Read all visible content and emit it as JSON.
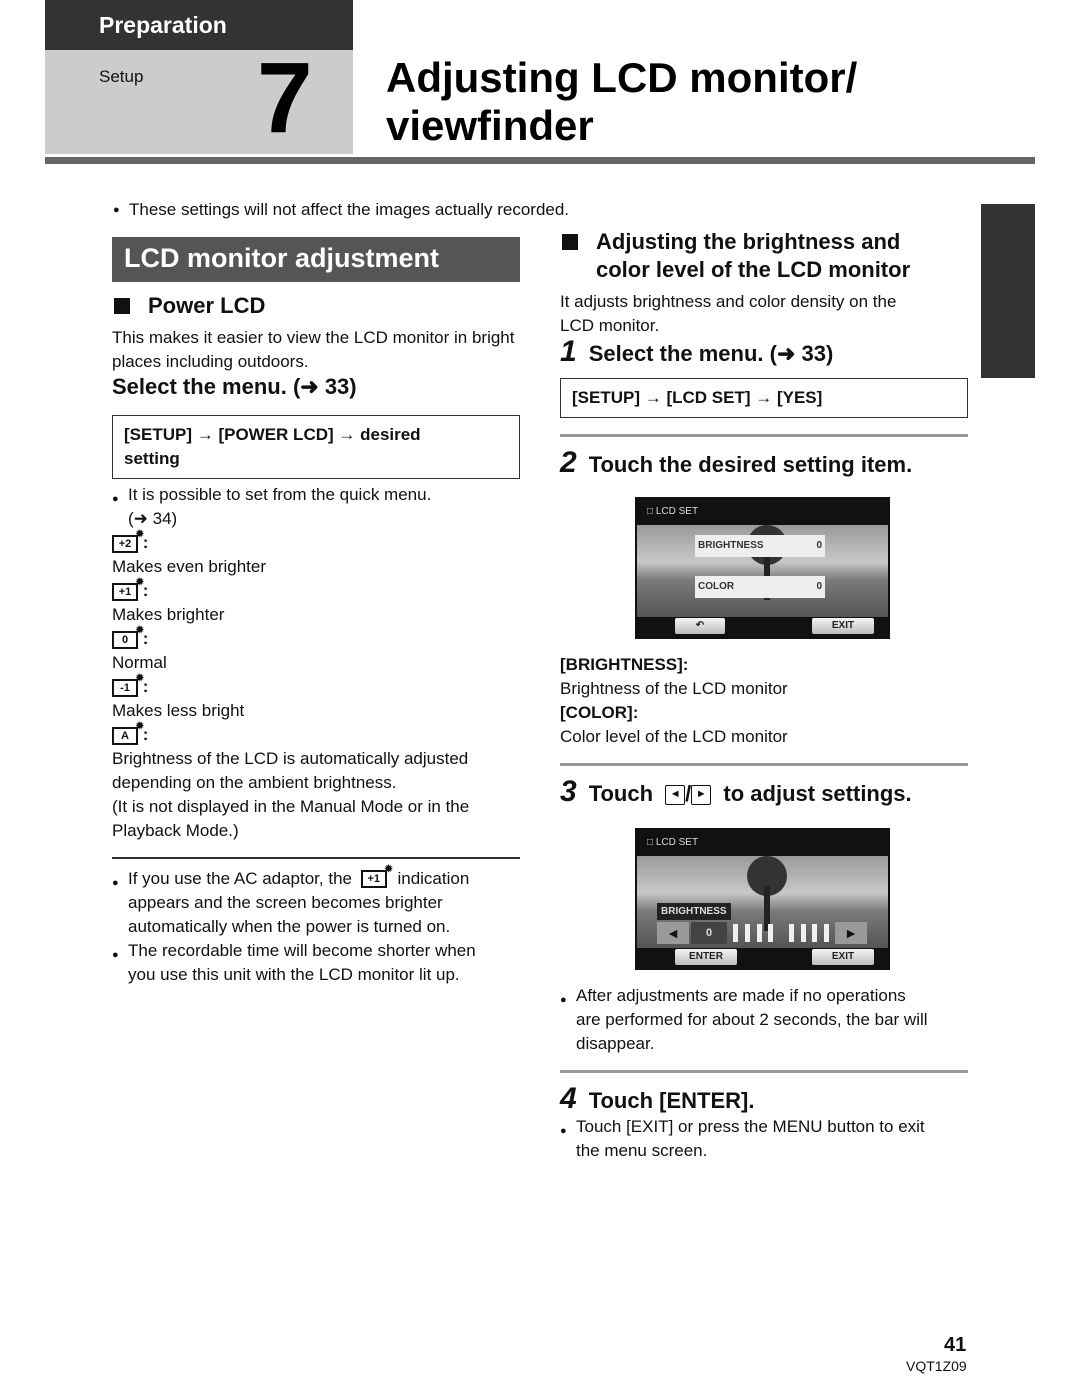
{
  "header": {
    "section": "Preparation",
    "subsection": "Setup",
    "chapter_number": "7",
    "title_line1": "Adjusting LCD monitor/",
    "title_line2": "viewfinder"
  },
  "top_note": "These settings will not affect the images actually recorded.",
  "left": {
    "section_title": "LCD monitor adjustment",
    "power_lcd": {
      "heading": "Power LCD",
      "intro": "This makes it easier to view the LCD monitor in bright places including outdoors.",
      "step": "Select the menu. (➜ 33)",
      "menu_path_line1": "[SETUP] → [POWER LCD] → desired",
      "menu_path_line2": "setting",
      "quick_menu_note_line1": "It is possible to set from the quick menu.",
      "quick_menu_note_line2": "(➜ 34)",
      "options": [
        {
          "icon_label": "+2",
          "icon": "brightness-plus2-icon",
          "desc": "Makes even brighter"
        },
        {
          "icon_label": "+1",
          "icon": "brightness-plus1-icon",
          "desc": "Makes brighter"
        },
        {
          "icon_label": "0",
          "icon": "brightness-0-icon",
          "desc": "Normal"
        },
        {
          "icon_label": "-1",
          "icon": "brightness-minus1-icon",
          "desc": "Makes less bright"
        },
        {
          "icon_label": "A",
          "icon": "brightness-auto-icon",
          "desc_line1": "Brightness of the LCD is automatically adjusted",
          "desc_line2": "depending on the ambient brightness.",
          "desc_line3": "(It is not displayed in the Manual Mode or in the",
          "desc_line4": "Playback Mode.)"
        }
      ],
      "notes": {
        "ac_prefix": "If you use the AC adaptor, the",
        "ac_icon_label": "+1",
        "ac_suffix": "indication",
        "ac_line2": "appears and the screen becomes brighter",
        "ac_line3": "automatically when the power is turned on.",
        "rec_line1": "The recordable time will become shorter when",
        "rec_line2": "you use this unit with the LCD monitor lit up."
      }
    }
  },
  "right": {
    "heading_line1": "Adjusting the brightness and",
    "heading_line2": "color level of the LCD monitor",
    "intro_line1": "It adjusts brightness and color density on the",
    "intro_line2": "LCD monitor.",
    "step1": {
      "num": "1",
      "text": "Select the menu. (➜ 33)",
      "menu_path": "[SETUP] → [LCD SET] → [YES]"
    },
    "step2": {
      "num": "2",
      "text": "Touch the desired setting item.",
      "screen": {
        "title": "LCD SET",
        "brightness_label": "BRIGHTNESS",
        "brightness_value": "0",
        "color_label": "COLOR",
        "color_value": "0",
        "back_label": "↶",
        "exit_label": "EXIT"
      },
      "defs": [
        {
          "term": "[BRIGHTNESS]:",
          "desc": "Brightness of the LCD monitor"
        },
        {
          "term": "[COLOR]:",
          "desc": "Color level of the LCD monitor"
        }
      ]
    },
    "step3": {
      "num": "3",
      "prefix": "Touch",
      "left_arrow": "◄",
      "sep": "/",
      "right_arrow": "►",
      "suffix": "to adjust settings.",
      "screen": {
        "title": "LCD SET",
        "label": "BRIGHTNESS",
        "value": "0",
        "left": "◄",
        "right": "►",
        "enter_label": "ENTER",
        "exit_label": "EXIT"
      },
      "note_line1": "After adjustments are made if no operations",
      "note_line2": "are performed for about 2 seconds, the bar will",
      "note_line3": "disappear."
    },
    "step4": {
      "num": "4",
      "text": "Touch [ENTER].",
      "note_line1": "Touch [EXIT] or press the MENU button to exit",
      "note_line2": "the menu screen."
    }
  },
  "footer": {
    "page_number": "41",
    "doc_code": "VQT1Z09"
  }
}
